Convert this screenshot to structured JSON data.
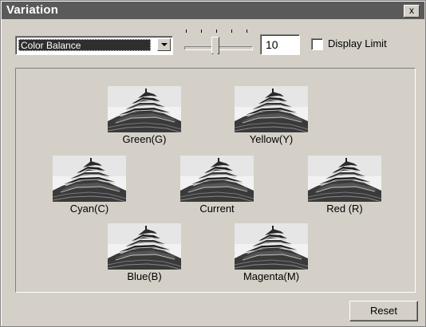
{
  "window": {
    "title": "Variation",
    "close_label": "x"
  },
  "controls": {
    "mode": {
      "selected": "Color Balance"
    },
    "slider": {
      "value": 10,
      "ticks": 5,
      "position": 0.5
    },
    "step_value": "10",
    "display_limit": {
      "label": "Display Limit",
      "checked": false
    }
  },
  "variations": [
    {
      "key": "green",
      "label": "Green(G)"
    },
    {
      "key": "yellow",
      "label": "Yellow(Y)"
    },
    {
      "key": "cyan",
      "label": "Cyan(C)"
    },
    {
      "key": "current",
      "label": "Current"
    },
    {
      "key": "red",
      "label": "Red (R)"
    },
    {
      "key": "blue",
      "label": "Blue(B)"
    },
    {
      "key": "magenta",
      "label": "Magenta(M)"
    }
  ],
  "buttons": {
    "reset": "Reset"
  },
  "colors": {
    "titlebar": "#5a5a5a",
    "face": "#d4d0c8"
  }
}
